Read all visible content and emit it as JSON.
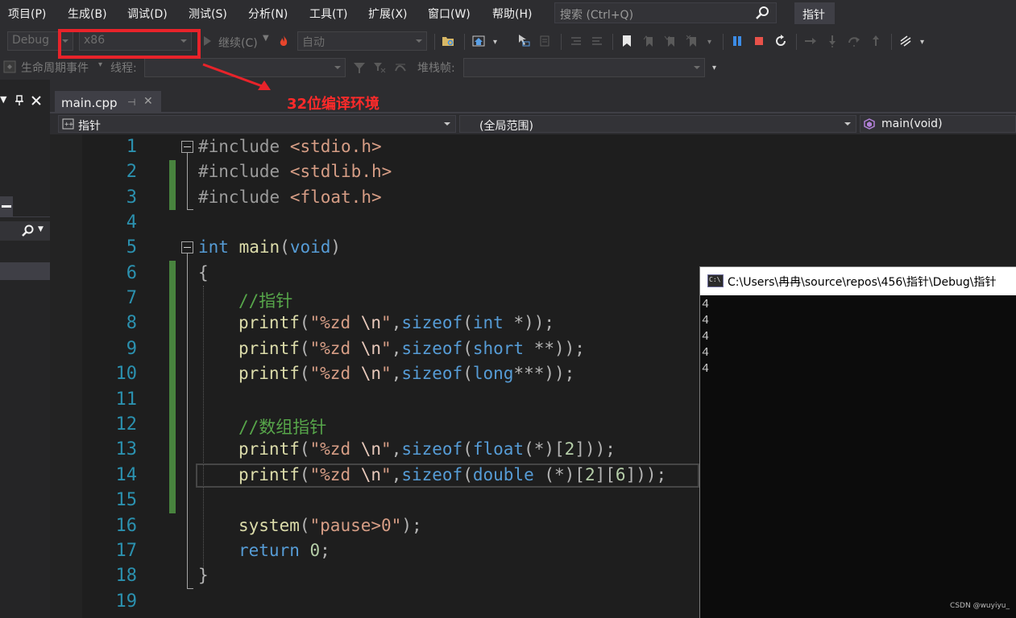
{
  "menu": [
    "项目(P)",
    "生成(B)",
    "调试(D)",
    "测试(S)",
    "分析(N)",
    "工具(T)",
    "扩展(X)",
    "窗口(W)",
    "帮助(H)"
  ],
  "search": {
    "placeholder": "搜索 (Ctrl+Q)"
  },
  "solution_name": "指针",
  "toolbar": {
    "configuration": "Debug",
    "platform": "x86",
    "continue_label": "继续(C)",
    "auto_combo": "自动",
    "lifecycle_label": "生命周期事件",
    "thread_label": "线程:",
    "stackframe_label": "堆栈帧:"
  },
  "annotation": {
    "text": "32位编译环境",
    "color": "#e8232a"
  },
  "tab": {
    "filename": "main.cpp"
  },
  "nav": {
    "project": "指针",
    "scope": "(全局范围)",
    "member": "main(void)"
  },
  "line_numbers": [
    "1",
    "2",
    "3",
    "4",
    "5",
    "6",
    "7",
    "8",
    "9",
    "10",
    "11",
    "12",
    "13",
    "14",
    "15",
    "16",
    "17",
    "18",
    "19"
  ],
  "code": {
    "l1": {
      "directive": "#include",
      "header": "<stdio.h>"
    },
    "l2": {
      "directive": "#include",
      "header": "<stdlib.h>"
    },
    "l3": {
      "directive": "#include",
      "header": "<float.h>"
    },
    "l5": {
      "type": "int",
      "name": "main",
      "open": "(",
      "param": "void",
      "close": ")"
    },
    "l6": "{",
    "l7": "//指针",
    "l8": {
      "fn": "printf",
      "fmt": "\"%zd ",
      "esc": "\\n",
      "q": "\"",
      "sizeof": "sizeof",
      "type": "int",
      "rest": " *",
      "end": "));"
    },
    "l9": {
      "fn": "printf",
      "fmt": "\"%zd ",
      "esc": "\\n",
      "q": "\"",
      "sizeof": "sizeof",
      "type": "short",
      "rest": " **",
      "end": "));"
    },
    "l10": {
      "fn": "printf",
      "fmt": "\"%zd ",
      "esc": "\\n",
      "q": "\"",
      "sizeof": "sizeof",
      "type": "long",
      "rest": "***",
      "end": "));"
    },
    "l12": "//数组指针",
    "l13": {
      "fn": "printf",
      "fmt": "\"%zd ",
      "esc": "\\n",
      "q": "\"",
      "sizeof": "sizeof",
      "type": "float",
      "rest": "(*)",
      "dims": [
        "2"
      ],
      "end": "));"
    },
    "l14": {
      "fn": "printf",
      "fmt": "\"%zd ",
      "esc": "\\n",
      "q": "\"",
      "sizeof": "sizeof",
      "type": "double",
      "rest": " (*)",
      "dims": [
        "2",
        "6"
      ],
      "end": "));"
    },
    "l16": {
      "fn": "system",
      "str": "\"pause>0\"",
      "end": ");"
    },
    "l17": {
      "kw": "return",
      "val": "0",
      "end": ";"
    },
    "l18": "}"
  },
  "console": {
    "title": "C:\\Users\\冉冉\\source\\repos\\456\\指针\\Debug\\指针",
    "output": [
      "4",
      "4",
      "4",
      "4",
      "4"
    ]
  },
  "watermark": "CSDN @wuyiyu_"
}
